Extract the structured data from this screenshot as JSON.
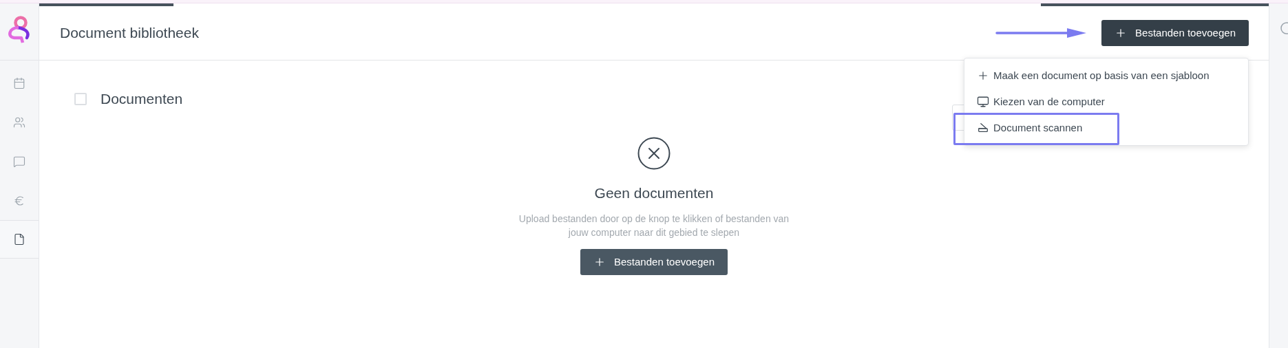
{
  "sidebar": {
    "items": [
      {
        "kind": "calendar",
        "selected": false
      },
      {
        "kind": "people",
        "selected": false
      },
      {
        "kind": "chat",
        "selected": false
      },
      {
        "kind": "euro",
        "selected": false
      },
      {
        "kind": "document",
        "selected": true
      }
    ]
  },
  "header": {
    "title": "Document bibliotheek",
    "add_button": "Bestanden toevoegen"
  },
  "menu": {
    "items": [
      {
        "kind": "plus",
        "label": "Maak een document op basis van een sjabloon",
        "highlighted": false
      },
      {
        "kind": "monitor",
        "label": "Kiezen van de computer",
        "highlighted": false
      },
      {
        "kind": "scanner",
        "label": "Document scannen",
        "highlighted": true
      }
    ]
  },
  "section": {
    "title": "Documenten",
    "checked": false
  },
  "empty_state": {
    "title": "Geen documenten",
    "message": "Upload bestanden door op de knop te klikken of bestanden van jouw computer naar dit gebied te slepen",
    "button": "Bestanden toevoegen"
  }
}
